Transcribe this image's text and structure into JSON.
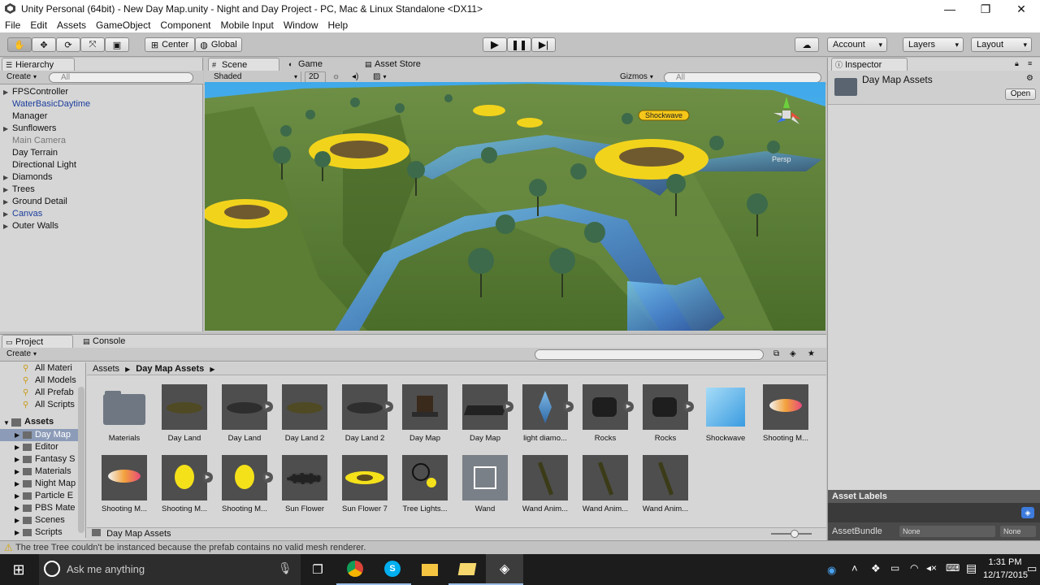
{
  "window": {
    "title": "Unity Personal (64bit) - New Day Map.unity - Night and Day Project - PC, Mac & Linux Standalone <DX11>"
  },
  "menu": [
    "File",
    "Edit",
    "Assets",
    "GameObject",
    "Component",
    "Mobile Input",
    "Window",
    "Help"
  ],
  "toolbar": {
    "pivot": "Center",
    "space": "Global",
    "account": "Account",
    "layers": "Layers",
    "layout": "Layout"
  },
  "hierarchy": {
    "tab": "Hierarchy",
    "create": "Create",
    "search_placeholder": "All",
    "items": [
      {
        "label": "FPSController",
        "style": "expand"
      },
      {
        "label": "WaterBasicDaytime",
        "style": "blue"
      },
      {
        "label": "Manager",
        "style": "plain"
      },
      {
        "label": "Sunflowers",
        "style": "expand"
      },
      {
        "label": "Main Camera",
        "style": "gray"
      },
      {
        "label": "Day Terrain",
        "style": "plain"
      },
      {
        "label": "Directional Light",
        "style": "plain"
      },
      {
        "label": "Diamonds",
        "style": "expand"
      },
      {
        "label": "Trees",
        "style": "expand"
      },
      {
        "label": "Ground Detail",
        "style": "expand"
      },
      {
        "label": "Canvas",
        "style": "blueexpand"
      },
      {
        "label": "Outer Walls",
        "style": "expand"
      }
    ]
  },
  "scene": {
    "tabs": [
      "Scene",
      "Game",
      "Asset Store"
    ],
    "shading": "Shaded",
    "mode2d": "2D",
    "gizmos": "Gizmos",
    "search_placeholder": "All",
    "label_shockwave": "Shockwave",
    "persp": "Persp"
  },
  "inspector": {
    "tab": "Inspector",
    "asset_name": "Day Map Assets",
    "open": "Open",
    "labels_title": "Asset Labels",
    "assetbundle": "AssetBundle",
    "none1": "None",
    "none2": "None"
  },
  "project": {
    "tabs": [
      "Project",
      "Console"
    ],
    "create": "Create",
    "favorites": [
      "All Materi",
      "All Models",
      "All Prefab",
      "All Scripts"
    ],
    "assets_root": "Assets",
    "folders": [
      "Day Map",
      "Editor",
      "Fantasy S",
      "Materials",
      "Night Map",
      "Particle E",
      "PBS Mate",
      "Scenes",
      "Scripts"
    ],
    "breadcrumb": [
      "Assets",
      "Day Map Assets"
    ],
    "footer_path": "Day Map Assets",
    "assets_row1": [
      "Materials",
      "Day Land",
      "Day Land",
      "Day Land 2",
      "Day Land 2",
      "Day Map",
      "Day Map",
      "light diamo...",
      "Rocks",
      "Rocks",
      "Shockwave",
      "Shooting M..."
    ],
    "assets_row2": [
      "Shooting M...",
      "Shooting M...",
      "Shooting M...",
      "Sun Flower",
      "Sun Flower 7",
      "Tree Lights...",
      "Wand",
      "Wand Anim...",
      "Wand Anim...",
      "Wand Anim..."
    ]
  },
  "status": {
    "message": "The tree Tree couldn't be instanced because the prefab contains no valid mesh renderer."
  },
  "taskbar": {
    "search": "Ask me anything",
    "time": "1:31 PM",
    "date": "12/17/2015"
  }
}
